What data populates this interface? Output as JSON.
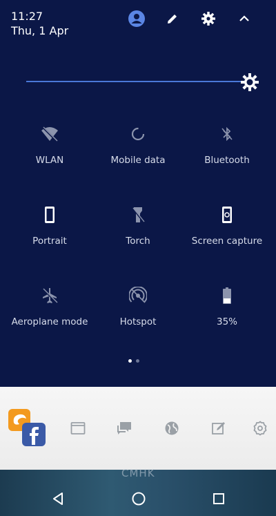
{
  "status": {
    "time": "11:27",
    "date": "Thu, 1 Apr"
  },
  "header_icons": [
    "account-icon",
    "edit-icon",
    "settings-icon",
    "collapse-icon"
  ],
  "brightness": {
    "level": 0.95
  },
  "tiles": [
    {
      "label": "WLAN",
      "icon": "wifi-off-icon"
    },
    {
      "label": "Mobile data",
      "icon": "mobile-data-icon"
    },
    {
      "label": "Bluetooth",
      "icon": "bluetooth-off-icon"
    },
    {
      "label": "Portrait",
      "icon": "portrait-icon"
    },
    {
      "label": "Torch",
      "icon": "torch-icon"
    },
    {
      "label": "Screen capture",
      "icon": "screen-capture-icon"
    },
    {
      "label": "Aeroplane mode",
      "icon": "airplane-icon"
    },
    {
      "label": "Hotspot",
      "icon": "hotspot-icon"
    },
    {
      "label": "35%",
      "icon": "battery-icon"
    }
  ],
  "pager": {
    "current": 1,
    "total": 2
  },
  "dock": [
    "uc-browser-icon",
    "facebook-icon",
    "browser-window-icon",
    "chat-icon",
    "globe-icon",
    "note-edit-icon",
    "settings-gear-icon"
  ],
  "wallpaper_text": "CMHK",
  "navbar": [
    "back-icon",
    "home-icon",
    "recents-icon"
  ],
  "colors": {
    "shade": "#0b1747",
    "accent": "#4a78d8",
    "avatar": "#5b86e5",
    "tile_inactive": "#8c94ad"
  }
}
